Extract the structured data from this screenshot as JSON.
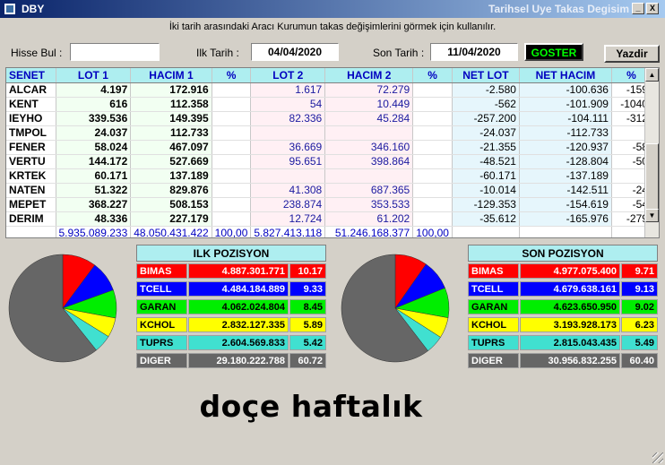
{
  "window": {
    "title": "DBY",
    "subtitle": "Tarihsel Uye Takas Degisim",
    "minimize_label": "_",
    "close_label": "X"
  },
  "info_text": "İki tarih arasındaki  Aracı Kurumun takas değişimlerini görmek için kullanılır.",
  "toolbar": {
    "hisse_label": "Hisse Bul :",
    "hisse_value": "",
    "ilk_tarih_label": "Ilk Tarih :",
    "ilk_tarih_value": "04/04/2020",
    "son_tarih_label": "Son Tarih :",
    "son_tarih_value": "11/04/2020",
    "goster_label": "GOSTER",
    "yazdir_label": "Yazdir"
  },
  "grid": {
    "headers": [
      "SENET",
      "LOT 1",
      "HACIM 1",
      "%",
      "LOT 2",
      "HACIM 2",
      "%",
      "NET LOT",
      "NET HACIM",
      "%"
    ],
    "rows": [
      [
        "ALCAR",
        "4.197",
        "172.916",
        "",
        "1.617",
        "72.279",
        "",
        "-2.580",
        "-100.636",
        "-159"
      ],
      [
        "KENT",
        "616",
        "112.358",
        "",
        "54",
        "10.449",
        "",
        "-562",
        "-101.909",
        "-1040"
      ],
      [
        "IEYHO",
        "339.536",
        "149.395",
        "",
        "82.336",
        "45.284",
        "",
        "-257.200",
        "-104.111",
        "-312"
      ],
      [
        "TMPOL",
        "24.037",
        "112.733",
        "",
        "",
        "",
        "",
        "-24.037",
        "-112.733",
        ""
      ],
      [
        "FENER",
        "58.024",
        "467.097",
        "",
        "36.669",
        "346.160",
        "",
        "-21.355",
        "-120.937",
        "-58"
      ],
      [
        "VERTU",
        "144.172",
        "527.669",
        "",
        "95.651",
        "398.864",
        "",
        "-48.521",
        "-128.804",
        "-50"
      ],
      [
        "KRTEK",
        "60.171",
        "137.189",
        "",
        "",
        "",
        "",
        "-60.171",
        "-137.189",
        ""
      ],
      [
        "NATEN",
        "51.322",
        "829.876",
        "",
        "41.308",
        "687.365",
        "",
        "-10.014",
        "-142.511",
        "-24"
      ],
      [
        "MEPET",
        "368.227",
        "508.153",
        "",
        "238.874",
        "353.533",
        "",
        "-129.353",
        "-154.619",
        "-54"
      ],
      [
        "DERIM",
        "48.336",
        "227.179",
        "",
        "12.724",
        "61.202",
        "",
        "-35.612",
        "-165.976",
        "-279"
      ]
    ],
    "totals": [
      "",
      "5.935.089.233",
      "48.050.431.422",
      "100,00",
      "5.827.413.118",
      "51.246.168.377",
      "100,00",
      "",
      "",
      ""
    ],
    "scroll_up": "▲",
    "scroll_down": "▼"
  },
  "ilk_pozisyon": {
    "title": "ILK POZISYON",
    "rows": [
      {
        "name": "BIMAS",
        "value": "4.887.301.771",
        "pct": "10.17",
        "bg": "#ff0000",
        "fg": "#ffffff"
      },
      {
        "name": "TCELL",
        "value": "4.484.184.889",
        "pct": "9.33",
        "bg": "#0000ff",
        "fg": "#ffffff"
      },
      {
        "name": "GARAN",
        "value": "4.062.024.804",
        "pct": "8.45",
        "bg": "#00ee00",
        "fg": "#000000"
      },
      {
        "name": "KCHOL",
        "value": "2.832.127.335",
        "pct": "5.89",
        "bg": "#ffff00",
        "fg": "#000000"
      },
      {
        "name": "TUPRS",
        "value": "2.604.569.833",
        "pct": "5.42",
        "bg": "#40e0d0",
        "fg": "#000000"
      },
      {
        "name": "DIGER",
        "value": "29.180.222.788",
        "pct": "60.72",
        "bg": "#666666",
        "fg": "#ffffff"
      }
    ]
  },
  "son_pozisyon": {
    "title": "SON POZISYON",
    "rows": [
      {
        "name": "BIMAS",
        "value": "4.977.075.400",
        "pct": "9.71",
        "bg": "#ff0000",
        "fg": "#ffffff"
      },
      {
        "name": "TCELL",
        "value": "4.679.638.161",
        "pct": "9.13",
        "bg": "#0000ff",
        "fg": "#ffffff"
      },
      {
        "name": "GARAN",
        "value": "4.623.650.950",
        "pct": "9.02",
        "bg": "#00ee00",
        "fg": "#000000"
      },
      {
        "name": "KCHOL",
        "value": "3.193.928.173",
        "pct": "6.23",
        "bg": "#ffff00",
        "fg": "#000000"
      },
      {
        "name": "TUPRS",
        "value": "2.815.043.435",
        "pct": "5.49",
        "bg": "#40e0d0",
        "fg": "#000000"
      },
      {
        "name": "DIGER",
        "value": "30.956.832.255",
        "pct": "60.40",
        "bg": "#666666",
        "fg": "#ffffff"
      }
    ]
  },
  "footer_text": "doçe haftalık"
}
